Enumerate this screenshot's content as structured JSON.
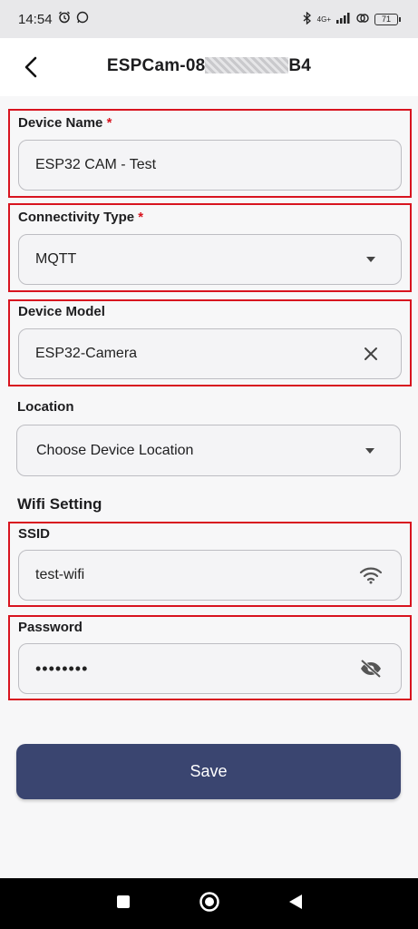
{
  "status_bar": {
    "time": "14:54",
    "network": "4G+",
    "battery": "71"
  },
  "header": {
    "title_prefix": "ESPCam-08",
    "title_suffix": "B4"
  },
  "form": {
    "device_name": {
      "label": "Device Name",
      "required_mark": "*",
      "value": "ESP32 CAM - Test"
    },
    "connectivity": {
      "label": "Connectivity Type",
      "required_mark": "*",
      "value": "MQTT"
    },
    "device_model": {
      "label": "Device Model",
      "value": "ESP32-Camera"
    },
    "location": {
      "label": "Location",
      "placeholder": "Choose Device Location"
    },
    "wifi_title": "Wifi Setting",
    "ssid": {
      "label": "SSID",
      "value": "test-wifi"
    },
    "password": {
      "label": "Password",
      "value": "••••••••"
    }
  },
  "actions": {
    "save_label": "Save"
  },
  "colors": {
    "highlight": "#d8141f",
    "button": "#3a4570",
    "required": "#d8141f"
  },
  "icons": [
    "back-arrow-icon",
    "dropdown-arrow-icon",
    "clear-icon",
    "wifi-icon",
    "visibility-off-icon",
    "nav-square-icon",
    "nav-home-icon",
    "nav-back-icon"
  ]
}
